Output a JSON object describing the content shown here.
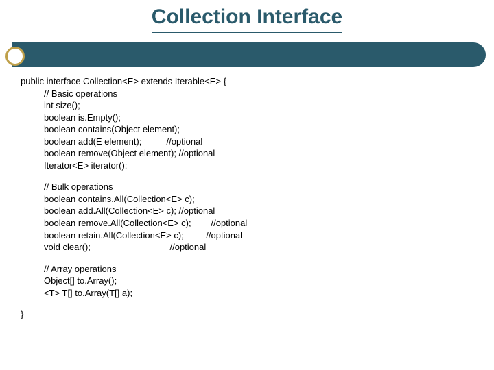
{
  "title": "Collection Interface",
  "code": {
    "decl": "public interface Collection<E> extends Iterable<E> {",
    "basic": {
      "comment": "// Basic operations",
      "lines": [
        "int size();",
        "boolean is.Empty();",
        "boolean contains(Object element);",
        "boolean add(E element);          //optional",
        "boolean remove(Object element); //optional",
        "Iterator<E> iterator();"
      ]
    },
    "bulk": {
      "comment": "// Bulk operations",
      "lines": [
        "boolean contains.All(Collection<E> c);",
        "boolean add.All(Collection<E> c); //optional",
        "boolean remove.All(Collection<E> c);        //optional",
        "boolean retain.All(Collection<E> c);         //optional",
        "void clear();                                //optional"
      ]
    },
    "array": {
      "comment": "// Array operations",
      "lines": [
        "Object[] to.Array();",
        "<T> T[] to.Array(T[] a);"
      ]
    },
    "close": "}"
  }
}
